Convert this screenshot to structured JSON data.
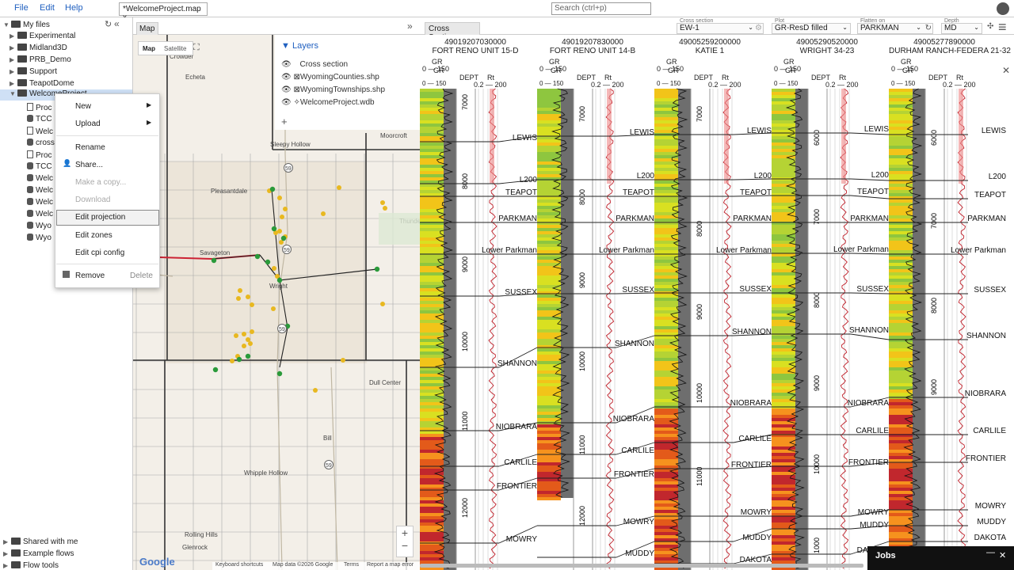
{
  "menubar": {
    "file": "File",
    "edit": "Edit",
    "help": "Help",
    "doc_tab": "*WelcomeProject.map x",
    "search_placeholder": "Search (ctrl+p)"
  },
  "sidebar": {
    "root": "My files",
    "folders": [
      "Experimental",
      "Midland3D",
      "PRB_Demo",
      "Support",
      "TeapotDome"
    ],
    "selected": "WelcomeProject",
    "children": [
      "Proc",
      "TCC",
      "Welc",
      "cross",
      "Proc",
      "TCC",
      "Welc",
      "Welc",
      "Welc",
      "Welc",
      "Wyo",
      "Wyo"
    ],
    "bottom": [
      "Shared with me",
      "Example flows",
      "Flow tools"
    ]
  },
  "context_menu": {
    "new": "New",
    "upload": "Upload",
    "rename": "Rename",
    "share": "Share...",
    "make_copy": "Make a copy...",
    "download": "Download",
    "edit_projection": "Edit projection",
    "edit_zones": "Edit zones",
    "edit_cpi": "Edit cpi config",
    "remove": "Remove",
    "delete": "Delete"
  },
  "map": {
    "tab": "Map",
    "type_map": "Map",
    "type_satellite": "Satellite",
    "places": [
      "Crowder",
      "Echeta",
      "Sleepy Hollow",
      "Moorcroft",
      "Pleasantdale",
      "Savageton",
      "Wright",
      "Thunder Basin National Grassland",
      "Dull Center",
      "Bill",
      "Whipple Hollow",
      "Rolling Hills",
      "Glenrock"
    ],
    "routes": [
      "59",
      "59",
      "59",
      "59"
    ],
    "attribution": [
      "Keyboard shortcuts",
      "Map data ©2026 Google",
      "Terms",
      "Report a map error"
    ],
    "google": "Google"
  },
  "layers": {
    "title": "Layers",
    "items": [
      "Cross section",
      "WyomingCounties.shp",
      "WyomingTownships.shp",
      "WelcomeProject.wdb"
    ]
  },
  "cross_section": {
    "tab": "Cross Section",
    "controls": {
      "cross_section_label": "Cross section",
      "cross_section_value": "EW-1",
      "plot_label": "Plot",
      "plot_value": "GR-ResD filled",
      "flatten_label": "Flatten on",
      "flatten_value": "PARKMAN",
      "depth_label": "Depth",
      "depth_value": "MD"
    },
    "wells": [
      {
        "uwi": "49019207030000",
        "name": "FORT RENO UNIT 15-D"
      },
      {
        "uwi": "49019207830000",
        "name": "FORT RENO UNIT 14-B"
      },
      {
        "uwi": "49005259200000",
        "name": "KATIE 1"
      },
      {
        "uwi": "49005290520000",
        "name": "WRIGHT 34-23"
      },
      {
        "uwi": "49005277890000",
        "name": "DURHAM RANCH-FEDERA 21-32"
      }
    ],
    "track_labels": {
      "gr": "GR",
      "gr_scale": "0 — 150",
      "depth": "DEPT",
      "rt": "Rt",
      "rt_scale": "0.2 — 200"
    },
    "tops": [
      "LEWIS",
      "L200",
      "TEAPOT",
      "PARKMAN",
      "Lower Parkman",
      "SUSSEX",
      "SHANNON",
      "NIOBRARA",
      "CARLILE",
      "FRONTIER",
      "MOWRY",
      "MUDDY",
      "DAKOTA"
    ],
    "depths_well1": [
      "7000",
      "8000",
      "9000",
      "10000",
      "11000",
      "12000"
    ],
    "depths_well2": [
      "7000",
      "8000",
      "9000",
      "10000",
      "11000",
      "12000"
    ],
    "depths_well3": [
      "7000",
      "8000",
      "9000",
      "10000",
      "11000"
    ],
    "depths_well4": [
      "6000",
      "7000",
      "8000",
      "9000",
      "10000",
      "1000"
    ],
    "depths_well5": [
      "6000",
      "7000",
      "8000",
      "9000"
    ]
  },
  "jobs": {
    "label": "Jobs"
  }
}
